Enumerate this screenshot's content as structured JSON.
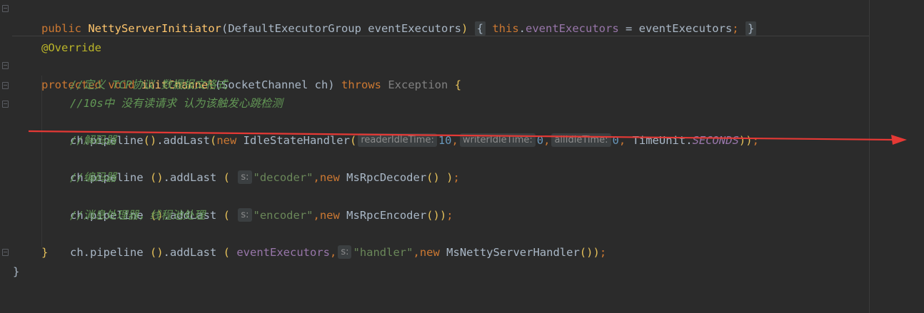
{
  "editor": {
    "colors": {
      "background": "#2b2b2b",
      "keyword": "#cc7832",
      "function": "#ffc66d",
      "comment": "#629755",
      "string": "#6a8759",
      "number": "#6897bb",
      "field": "#9876aa",
      "annotation": "#bbb529",
      "arrow": "#e53935"
    },
    "constructor_line": {
      "public": "public",
      "name": "NettyServerInitiator",
      "open": "(",
      "params": "DefaultExecutorGroup eventExecutors",
      "close": ")",
      "fold_open": "{",
      "this": "this",
      "dot": ".",
      "field": "eventExecutors",
      "assign": " = eventExecutors",
      "semi": ";",
      "fold_close": "}"
    },
    "annotation": "@Override",
    "method_line": {
      "protected": "protected",
      "void": "void",
      "name": "initChannel",
      "params": "(SocketChannel ch)",
      "throws": "throws",
      "exception": "Exception",
      "brace": "{"
    },
    "comment1": "//定义 TCP协议 数据报文格式",
    "comment2": "//10s中 没有读请求 认为该触发心跳检测",
    "idle_line": {
      "prefix": "ch.pipeline",
      "p1": "()",
      "addlast": ".addLast",
      "p2": "(",
      "new": "new",
      "cls": " IdleStateHandler",
      "p3": "(",
      "hint1": "readerIdleTime:",
      "v1": "10",
      "comma": ",",
      "hint2": "writerIdleTime:",
      "v2": "0",
      "hint3": "allIdleTime:",
      "v3": "0",
      "timeunit": " TimeUnit.",
      "constant": "SECONDS",
      "p4": ")",
      "p5": ")",
      "semi": ";"
    },
    "comment3": "//解码器",
    "decoder_line": {
      "prefix": "ch.pipeline ",
      "p1": "()",
      "addlast": ".addLast ",
      "p2": "(",
      "hint": "s:",
      "string": "\"decoder\"",
      "comma": ",",
      "new": "new",
      "cls": " MsRpcDecoder",
      "p3": "()",
      "p4": " )",
      "semi": ";"
    },
    "comment4": "//编码器",
    "encoder_line": {
      "prefix": "ch.pipeline ",
      "p1": "()",
      "addlast": ".addLast ",
      "p2": "(",
      "hint": "s:",
      "string": "\"encoder\"",
      "comma": ",",
      "new": "new",
      "cls": " MsRpcEncoder",
      "p3": "()",
      "p4": ")",
      "semi": ";"
    },
    "comment5": "//消息处理器，线程池处理",
    "handler_line": {
      "prefix": "ch.pipeline ",
      "p1": "()",
      "addlast": ".addLast ",
      "p2": "(",
      "arg": " eventExecutors",
      "comma": ",",
      "hint": "s:",
      "string": "\"handler\"",
      "comma2": ",",
      "new": "new",
      "cls": " MsNettyServerHandler",
      "p3": "()",
      "p4": ")",
      "semi": ";"
    },
    "close_method": "}",
    "close_class": "}"
  }
}
